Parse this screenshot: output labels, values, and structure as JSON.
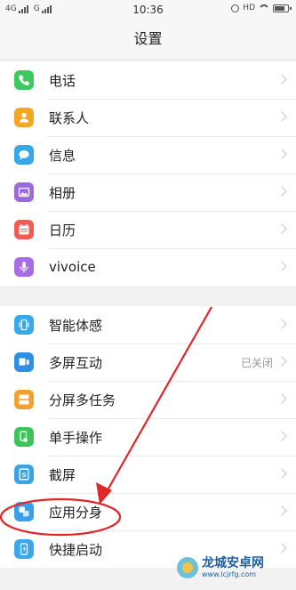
{
  "status_bar": {
    "signal1_label": "4G",
    "signal2_label": "G",
    "time": "10:36",
    "hd_label": "HD"
  },
  "header": {
    "title": "设置"
  },
  "groups": [
    {
      "items": [
        {
          "label": "电话",
          "icon": "phone-icon",
          "color": "#3dc95f"
        },
        {
          "label": "联系人",
          "icon": "contacts-icon",
          "color": "#f5a623"
        },
        {
          "label": "信息",
          "icon": "message-icon",
          "color": "#35a7e8"
        },
        {
          "label": "相册",
          "icon": "album-icon",
          "color": "#9b6ad9"
        },
        {
          "label": "日历",
          "icon": "calendar-icon",
          "color": "#f25c54"
        },
        {
          "label": "vivoice",
          "icon": "microphone-icon",
          "color": "#a76ce6"
        }
      ]
    },
    {
      "items": [
        {
          "label": "智能体感",
          "icon": "smart-motion-icon",
          "color": "#38a8ea",
          "value": ""
        },
        {
          "label": "多屏互动",
          "icon": "multiscreen-icon",
          "color": "#2f8fe0",
          "value": "已关闭"
        },
        {
          "label": "分屏多任务",
          "icon": "split-screen-icon",
          "color": "#f2a12e",
          "value": ""
        },
        {
          "label": "单手操作",
          "icon": "one-hand-icon",
          "color": "#3ec35a",
          "value": ""
        },
        {
          "label": "截屏",
          "icon": "screenshot-icon",
          "color": "#39a3e4",
          "value": ""
        },
        {
          "label": "应用分身",
          "icon": "app-clone-icon",
          "color": "#3aa0ea",
          "value": ""
        },
        {
          "label": "快捷启动",
          "icon": "quick-launch-icon",
          "color": "#38a8ea",
          "value": ""
        }
      ]
    }
  ],
  "watermark": {
    "name": "龙城安卓网",
    "url": "www.lcjrfg.com"
  },
  "annotation_color": "#e0282a"
}
